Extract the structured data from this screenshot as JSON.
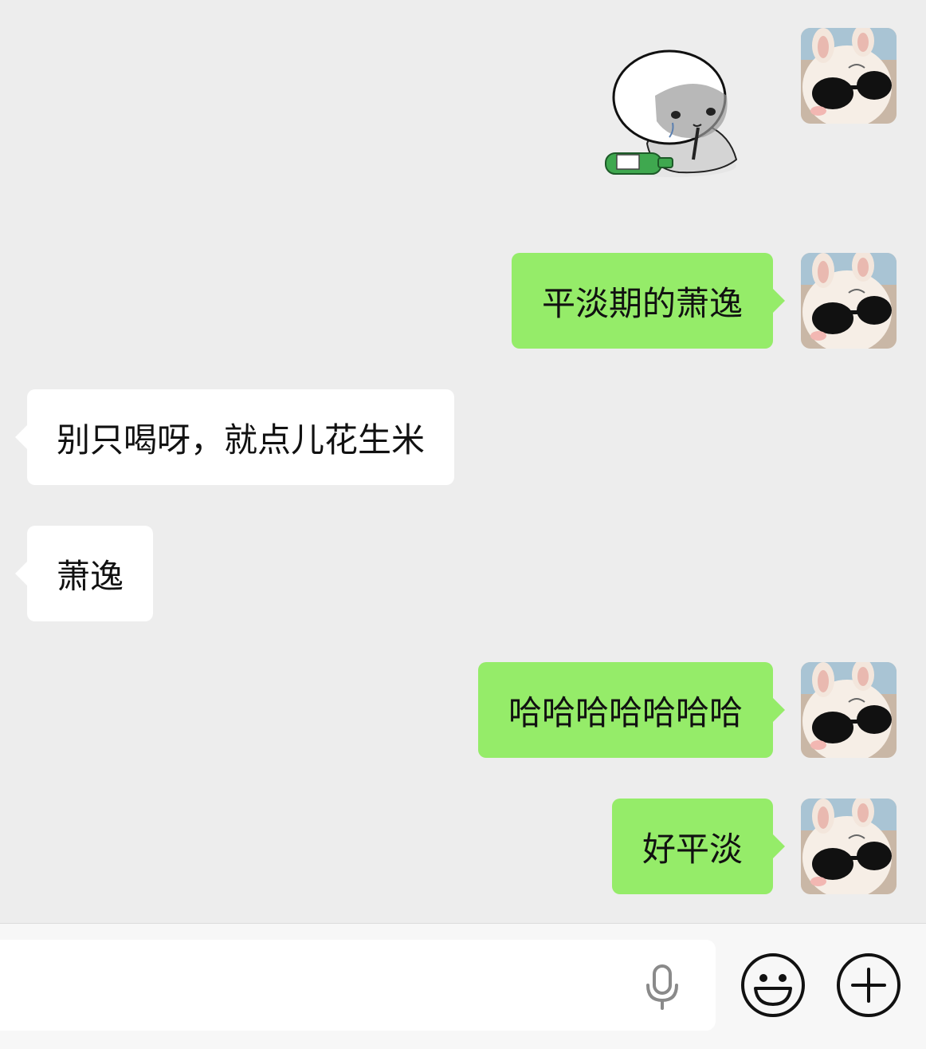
{
  "messages": [
    {
      "direction": "outgoing",
      "type": "sticker",
      "sticker": "crying-bun-drinking-bottle"
    },
    {
      "direction": "outgoing",
      "type": "text",
      "text": "平淡期的萧逸"
    },
    {
      "direction": "incoming",
      "type": "text",
      "text": "别只喝呀，就点儿花生米"
    },
    {
      "direction": "incoming",
      "type": "text",
      "text": "萧逸"
    },
    {
      "direction": "outgoing",
      "type": "text",
      "text": "哈哈哈哈哈哈哈"
    },
    {
      "direction": "outgoing",
      "type": "text",
      "text": "好平淡"
    }
  ],
  "input_bar": {
    "value": "",
    "icons": [
      "microphone-icon",
      "emoji-icon",
      "plus-icon"
    ]
  },
  "colors": {
    "background": "#ededed",
    "outgoing_bubble": "#95ec69",
    "incoming_bubble": "#ffffff"
  }
}
